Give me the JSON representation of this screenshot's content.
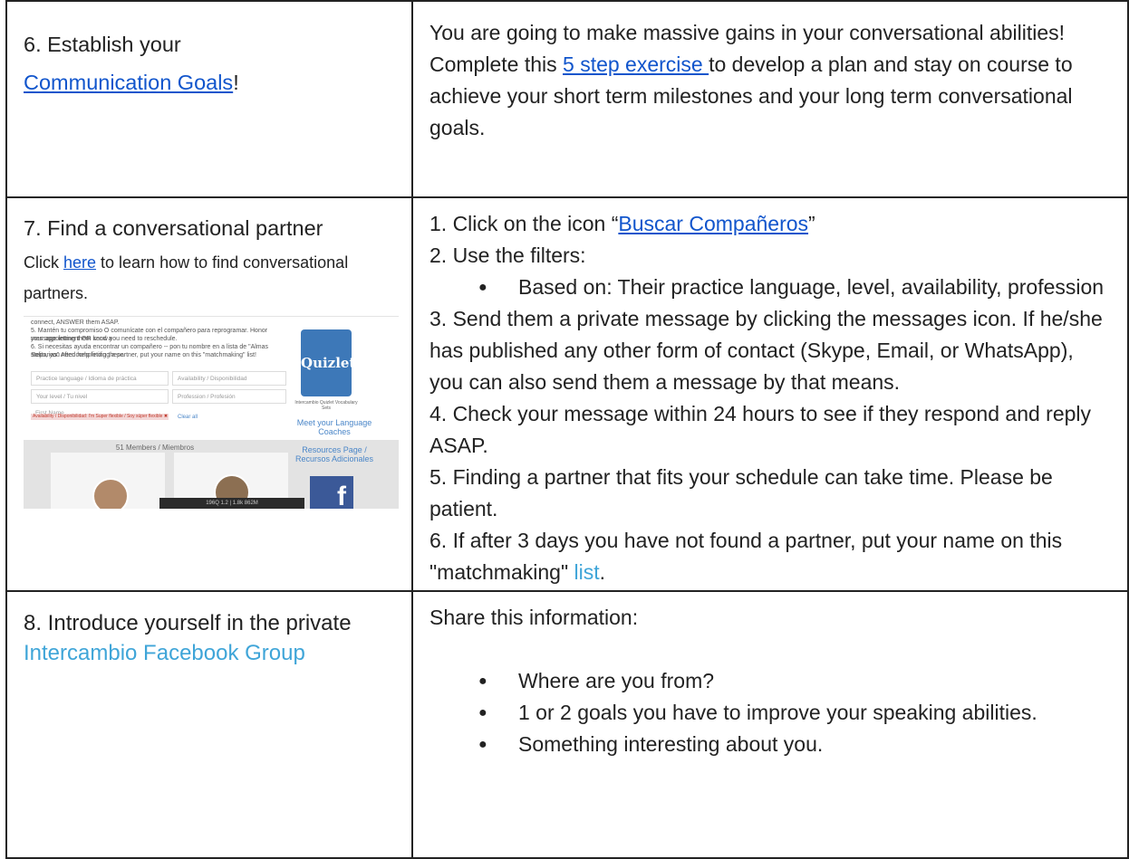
{
  "rows": [
    {
      "step_title_line1": "6. Establish your",
      "step_link": "Communication Goals",
      "step_link_after": "!",
      "text_line1": "You are going to make massive gains in your conversational abilities!",
      "text_line2_before": "Complete this ",
      "text_line2_link": "5 step exercise ",
      "text_line2_after": "to develop a plan and stay on course to achieve your short term milestones and your long term conversational goals."
    },
    {
      "step_title": "7. Find a conversational partner",
      "help_before": "Click ",
      "help_link": "here",
      "help_after": " to learn how to find conversational partners.",
      "screenshot": {
        "text1": "connect, ANSWER them ASAP.",
        "text2": "5. Mantén tu compromiso O comunícate con el compañero para reprogramar. Honor your appointment OR send a",
        "text3": "message letting them know you need to reschedule.",
        "text4": "6. Si necesitas ayuda encontrar un compañero -- pon tu nombre en a lista de \"Almas Solitarias\" After completing these",
        "text5": "steps, you need help finding a partner, put your name on this \"matchmaking\" list!",
        "field_practice_language": "Practice language / Idioma de práctica",
        "field_availability": "Availability / Disponibilidad",
        "field_level": "Your level / Tu nivel",
        "field_profession": "Profession / Profesión",
        "field_first_name": "First Name",
        "filter_tag": "Availability / Disponibilidad: I'm Super flexible / Soy súper flexible ✖",
        "clear_all": "Clear all",
        "quizlet_label": "Quizlet",
        "quizlet_caption": "Intercambio Quizlet Vocabulary Sets",
        "coaches_link": "Meet your Language Coaches",
        "resources_link": "Resources Page / Recursos Adicionales",
        "members_count": "51 Members / Miembros",
        "facebook_letter": "f",
        "status_bar": "196Q   1.2 | 1.8k   862M"
      },
      "steps": [
        {
          "before": "1. Click on the icon “",
          "link": "Buscar Compañeros",
          "after": "”"
        },
        {
          "text": "2. Use the filters:"
        }
      ],
      "filter_bullet": "Based on: Their practice language, level, availability, profession",
      "steps_after": [
        "3. Send them a private message by clicking the messages icon. If he/she has published any other form of contact (Skype, Email, or WhatsApp), you can also send them a message by that means.",
        "4. Check your message within 24 hours to see if they respond and reply ASAP.",
        "5. Finding a partner that fits your schedule can take time. Please be patient."
      ],
      "step6_before": "6. If after 3 days you have not found a partner, put your name on this \"matchmaking\" ",
      "step6_link": "list",
      "step6_after": "."
    },
    {
      "step_title_before": "8. Introduce yourself in the private ",
      "step_link": "Intercambio Facebook Group",
      "intro": "Share this information:",
      "bullets": [
        "Where are you from?",
        "1 or 2 goals you have to improve your speaking abilities.",
        "Something interesting about you."
      ]
    }
  ],
  "bullet_glyph": "●"
}
